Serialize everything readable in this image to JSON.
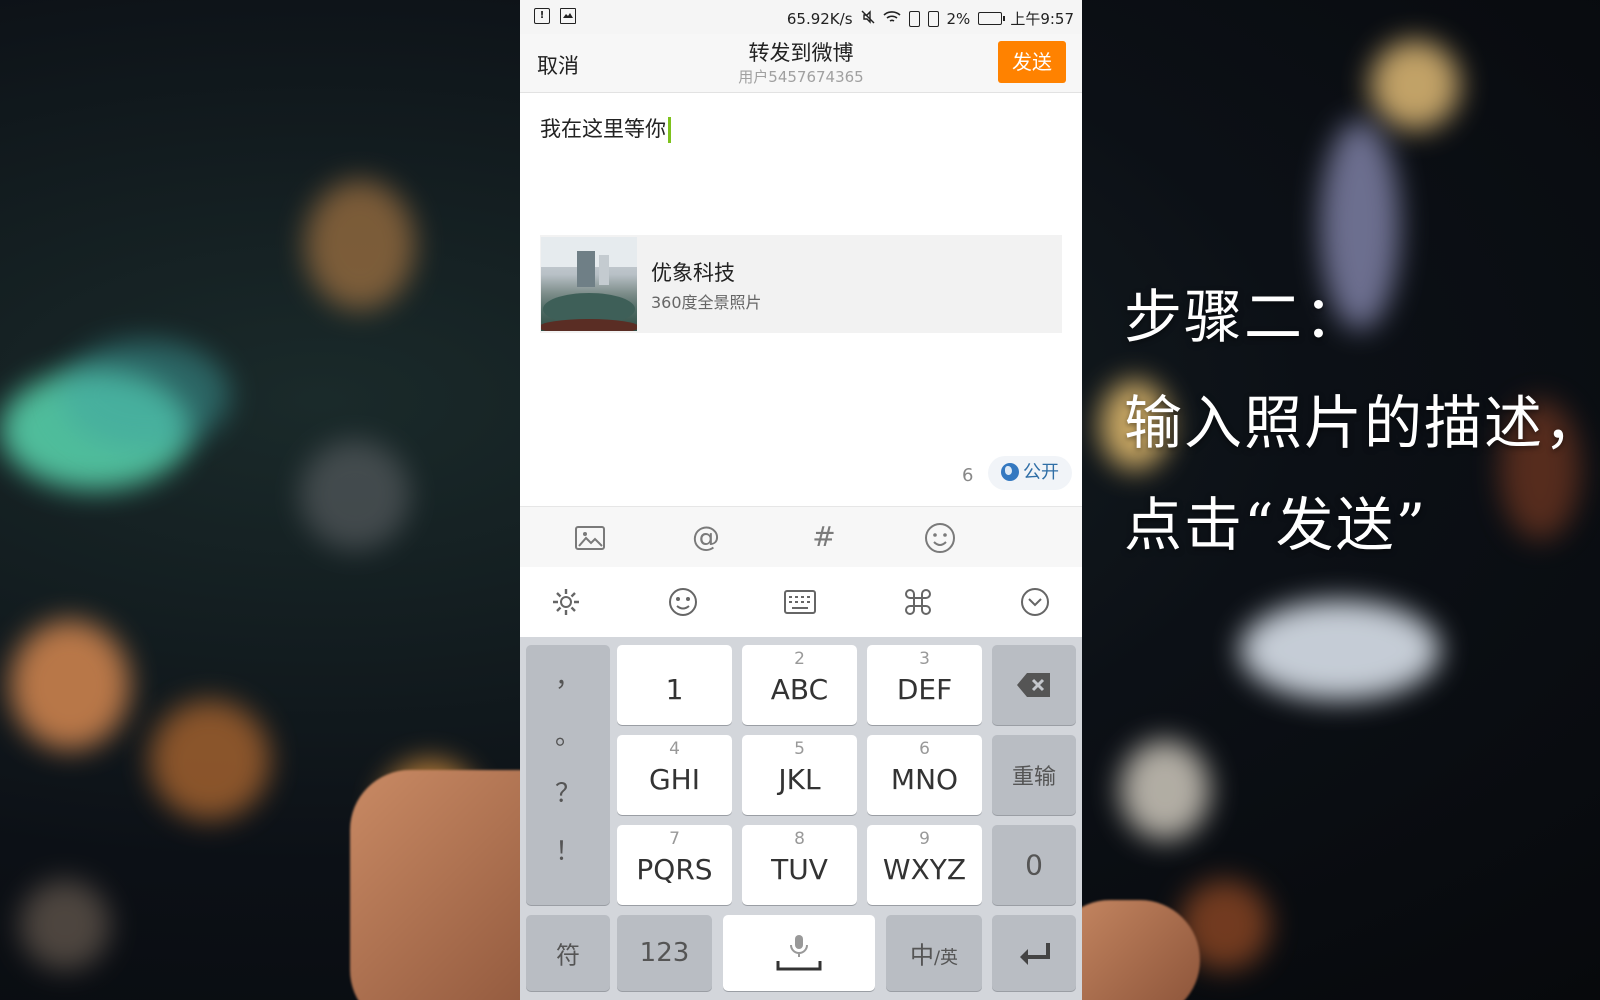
{
  "statusbar": {
    "speed": "65.92K/s",
    "battery": "2%",
    "time": "上午9:57",
    "notification_icon": "alert-icon",
    "image_icon": "image-icon"
  },
  "nav": {
    "cancel": "取消",
    "title": "转发到微博",
    "subtitle": "用户5457674365",
    "send": "发送"
  },
  "compose": {
    "text": "我在这里等你"
  },
  "card": {
    "title": "优象科技",
    "description": "360度全景照片"
  },
  "footer": {
    "count": "6",
    "visibility": "公开"
  },
  "toolbar": {
    "icons": [
      "image-icon",
      "mention-icon",
      "hashtag-icon",
      "emoji-icon"
    ],
    "at": "@",
    "hash": "#"
  },
  "keyboard_toolbar": {
    "icons": [
      "gear-icon",
      "emoji-face-icon",
      "keyboard-icon",
      "command-icon",
      "collapse-icon"
    ]
  },
  "keyboard": {
    "punct": [
      "，",
      "。",
      "？",
      "！"
    ],
    "keys": [
      {
        "num": "",
        "label": "1"
      },
      {
        "num": "2",
        "label": "ABC"
      },
      {
        "num": "3",
        "label": "DEF"
      },
      {
        "num": "4",
        "label": "GHI"
      },
      {
        "num": "5",
        "label": "JKL"
      },
      {
        "num": "6",
        "label": "MNO"
      },
      {
        "num": "7",
        "label": "PQRS"
      },
      {
        "num": "8",
        "label": "TUV"
      },
      {
        "num": "9",
        "label": "WXYZ"
      }
    ],
    "reinput": "重输",
    "zero": "0",
    "symbol": "符",
    "numeric": "123",
    "lang_main": "中",
    "lang_sub": "/英"
  },
  "instructions": {
    "line1": "步骤二：",
    "line2": "输入照片的描述，",
    "line3": "点击“发送”"
  },
  "colors": {
    "accent": "#ff8200",
    "link": "#2f6ea6",
    "caret": "#7ec21d"
  }
}
